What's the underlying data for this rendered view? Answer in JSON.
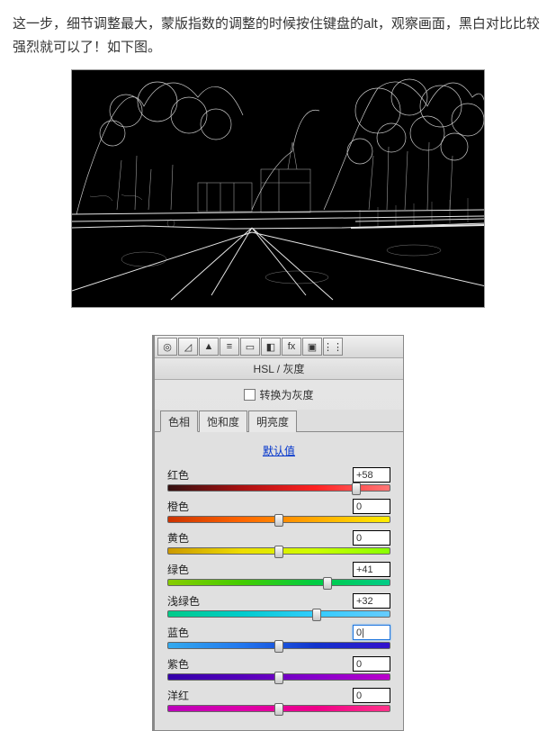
{
  "intro": "这一步，细节调整最大，蒙版指数的调整的时候按住键盘的alt，观察画面，黑白对比比较强烈就可以了！如下图。",
  "panel": {
    "title": "HSL / 灰度",
    "grayscale_label": "转换为灰度",
    "tabs": {
      "hue": "色相",
      "saturation": "饱和度",
      "luminance": "明亮度"
    },
    "default_label": "默认值",
    "toolbar_icons": [
      "◎",
      "◿",
      "▲",
      "≡",
      "▭",
      "◧",
      "fx",
      "▣",
      "⋮⋮"
    ]
  },
  "sliders": [
    {
      "label": "红色",
      "value": "+58",
      "pos": 85,
      "grad": "g-red",
      "active": false
    },
    {
      "label": "橙色",
      "value": "0",
      "pos": 50,
      "grad": "g-orange",
      "active": false
    },
    {
      "label": "黄色",
      "value": "0",
      "pos": 50,
      "grad": "g-yellow",
      "active": false
    },
    {
      "label": "绿色",
      "value": "+41",
      "pos": 72,
      "grad": "g-green",
      "active": false
    },
    {
      "label": "浅绿色",
      "value": "+32",
      "pos": 67,
      "grad": "g-aqua",
      "active": false
    },
    {
      "label": "蓝色",
      "value": "0|",
      "pos": 50,
      "grad": "g-blue",
      "active": true
    },
    {
      "label": "紫色",
      "value": "0",
      "pos": 50,
      "grad": "g-purple",
      "active": false
    },
    {
      "label": "洋红",
      "value": "0",
      "pos": 50,
      "grad": "g-magenta",
      "active": false
    }
  ]
}
